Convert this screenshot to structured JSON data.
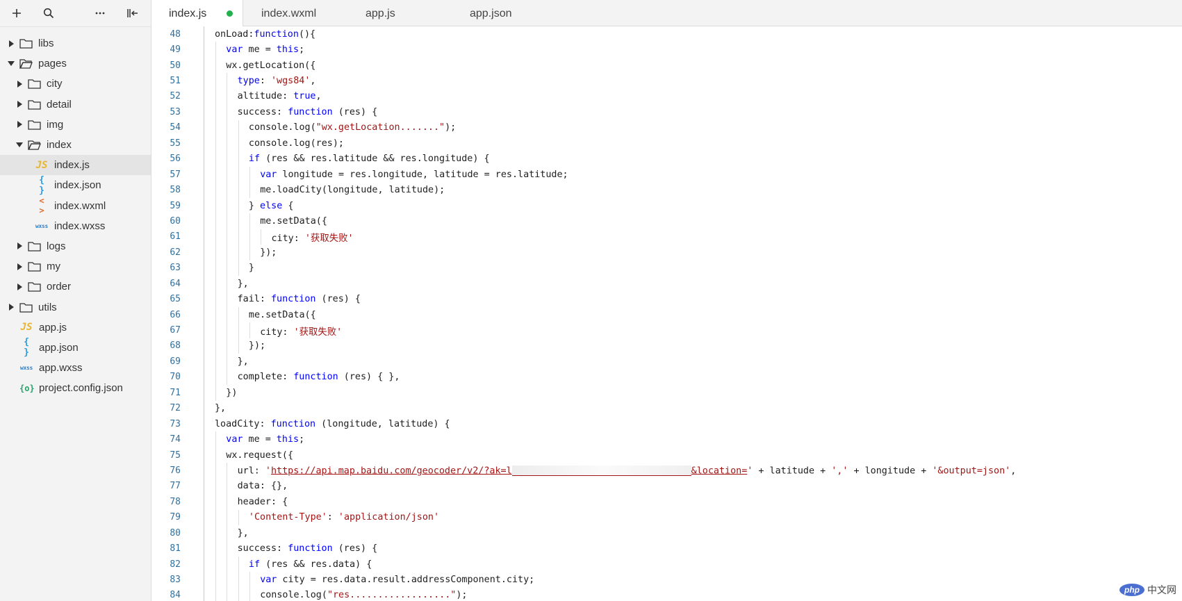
{
  "sidebar": {
    "toolbar": [
      {
        "name": "add-icon",
        "glyph": "+"
      },
      {
        "name": "search-icon",
        "glyph": ""
      },
      {
        "name": "more-icon",
        "glyph": "···"
      },
      {
        "name": "collapse-panel-icon",
        "glyph": ""
      }
    ],
    "tree": [
      {
        "label": "libs",
        "type": "folder",
        "depth": 0,
        "expanded": false
      },
      {
        "label": "pages",
        "type": "folder",
        "depth": 0,
        "expanded": true
      },
      {
        "label": "city",
        "type": "folder",
        "depth": 1,
        "expanded": false
      },
      {
        "label": "detail",
        "type": "folder",
        "depth": 1,
        "expanded": false
      },
      {
        "label": "img",
        "type": "folder",
        "depth": 1,
        "expanded": false
      },
      {
        "label": "index",
        "type": "folder",
        "depth": 1,
        "expanded": true
      },
      {
        "label": "index.js",
        "type": "js",
        "depth": 2,
        "selected": true
      },
      {
        "label": "index.json",
        "type": "json",
        "depth": 2
      },
      {
        "label": "index.wxml",
        "type": "wxml",
        "depth": 2
      },
      {
        "label": "index.wxss",
        "type": "wxss",
        "depth": 2
      },
      {
        "label": "logs",
        "type": "folder",
        "depth": 1,
        "expanded": false
      },
      {
        "label": "my",
        "type": "folder",
        "depth": 1,
        "expanded": false
      },
      {
        "label": "order",
        "type": "folder",
        "depth": 1,
        "expanded": false
      },
      {
        "label": "utils",
        "type": "folder",
        "depth": 0,
        "expanded": false
      },
      {
        "label": "app.js",
        "type": "js",
        "depth": 0
      },
      {
        "label": "app.json",
        "type": "json",
        "depth": 0
      },
      {
        "label": "app.wxss",
        "type": "wxss",
        "depth": 0
      },
      {
        "label": "project.config.json",
        "type": "config",
        "depth": 0
      }
    ],
    "icon_glyphs": {
      "js": "JS",
      "json": "{ }",
      "wxml": "< >",
      "wxss": "wxss",
      "config": "{o}"
    }
  },
  "tabs": [
    {
      "label": "index.js",
      "active": true,
      "modified": true
    },
    {
      "label": "index.wxml",
      "active": false
    },
    {
      "label": "app.js",
      "active": false
    },
    {
      "label": "app.json",
      "active": false
    }
  ],
  "editor": {
    "first_line": 48,
    "lines": [
      {
        "indent": 0,
        "tokens": [
          [
            "p",
            "onLoad:"
          ],
          [
            "k",
            "function"
          ],
          [
            "p",
            "(){"
          ]
        ]
      },
      {
        "indent": 1,
        "tokens": [
          [
            "k",
            "var"
          ],
          [
            "p",
            " me = "
          ],
          [
            "k",
            "this"
          ],
          [
            "p",
            ";"
          ]
        ]
      },
      {
        "indent": 1,
        "tokens": [
          [
            "p",
            "wx.getLocation({"
          ]
        ]
      },
      {
        "indent": 2,
        "tokens": [
          [
            "k",
            "type"
          ],
          [
            "p",
            ": "
          ],
          [
            "s",
            "'wgs84'"
          ],
          [
            "p",
            ","
          ]
        ]
      },
      {
        "indent": 2,
        "tokens": [
          [
            "p",
            "altitude: "
          ],
          [
            "k",
            "true"
          ],
          [
            "p",
            ","
          ]
        ]
      },
      {
        "indent": 2,
        "tokens": [
          [
            "p",
            "success: "
          ],
          [
            "k",
            "function"
          ],
          [
            "p",
            " (res) {"
          ]
        ]
      },
      {
        "indent": 3,
        "tokens": [
          [
            "p",
            "console.log("
          ],
          [
            "s",
            "\"wx.getLocation.......\""
          ],
          [
            "p",
            ");"
          ]
        ]
      },
      {
        "indent": 3,
        "tokens": [
          [
            "p",
            "console.log(res);"
          ]
        ]
      },
      {
        "indent": 3,
        "tokens": [
          [
            "k",
            "if"
          ],
          [
            "p",
            " (res && res.latitude && res.longitude) {"
          ]
        ]
      },
      {
        "indent": 4,
        "tokens": [
          [
            "k",
            "var"
          ],
          [
            "p",
            " longitude = res.longitude, latitude = res.latitude;"
          ]
        ]
      },
      {
        "indent": 4,
        "tokens": [
          [
            "p",
            "me.loadCity(longitude, latitude);"
          ]
        ]
      },
      {
        "indent": 3,
        "tokens": [
          [
            "p",
            "} "
          ],
          [
            "k",
            "else"
          ],
          [
            "p",
            " {"
          ]
        ]
      },
      {
        "indent": 4,
        "tokens": [
          [
            "p",
            "me.setData({"
          ]
        ]
      },
      {
        "indent": 5,
        "tokens": [
          [
            "p",
            "city: "
          ],
          [
            "s",
            "'获取失败'"
          ]
        ]
      },
      {
        "indent": 4,
        "tokens": [
          [
            "p",
            "});"
          ]
        ]
      },
      {
        "indent": 3,
        "tokens": [
          [
            "p",
            "}"
          ]
        ]
      },
      {
        "indent": 2,
        "tokens": [
          [
            "p",
            "},"
          ]
        ]
      },
      {
        "indent": 2,
        "tokens": [
          [
            "p",
            "fail: "
          ],
          [
            "k",
            "function"
          ],
          [
            "p",
            " (res) {"
          ]
        ]
      },
      {
        "indent": 3,
        "tokens": [
          [
            "p",
            "me.setData({"
          ]
        ]
      },
      {
        "indent": 4,
        "tokens": [
          [
            "p",
            "city: "
          ],
          [
            "s",
            "'获取失败'"
          ]
        ]
      },
      {
        "indent": 3,
        "tokens": [
          [
            "p",
            "});"
          ]
        ]
      },
      {
        "indent": 2,
        "tokens": [
          [
            "p",
            "},"
          ]
        ]
      },
      {
        "indent": 2,
        "tokens": [
          [
            "p",
            "complete: "
          ],
          [
            "k",
            "function"
          ],
          [
            "p",
            " (res) { },"
          ]
        ]
      },
      {
        "indent": 1,
        "tokens": [
          [
            "p",
            "})"
          ]
        ]
      },
      {
        "indent": 0,
        "tokens": [
          [
            "p",
            "},"
          ]
        ]
      },
      {
        "indent": 0,
        "tokens": [
          [
            "p",
            "loadCity: "
          ],
          [
            "k",
            "function"
          ],
          [
            "p",
            " (longitude, latitude) {"
          ]
        ]
      },
      {
        "indent": 1,
        "tokens": [
          [
            "k",
            "var"
          ],
          [
            "p",
            " me = "
          ],
          [
            "k",
            "this"
          ],
          [
            "p",
            ";"
          ]
        ]
      },
      {
        "indent": 1,
        "tokens": [
          [
            "p",
            "wx.request({"
          ]
        ]
      },
      {
        "indent": 2,
        "tokens": [
          [
            "p",
            "url: "
          ],
          [
            "s",
            "'"
          ],
          [
            "u",
            "https://api.map.baidu.com/geocoder/v2/?ak=l"
          ],
          [
            "b",
            ""
          ],
          [
            "u",
            "&location="
          ],
          [
            "s",
            "'"
          ],
          [
            "p",
            " + latitude + "
          ],
          [
            "s",
            "','"
          ],
          [
            "p",
            " + longitude + "
          ],
          [
            "s",
            "'&output=json'"
          ],
          [
            "p",
            ","
          ]
        ]
      },
      {
        "indent": 2,
        "tokens": [
          [
            "p",
            "data: {},"
          ]
        ]
      },
      {
        "indent": 2,
        "tokens": [
          [
            "p",
            "header: {"
          ]
        ]
      },
      {
        "indent": 3,
        "tokens": [
          [
            "s",
            "'Content-Type'"
          ],
          [
            "p",
            ": "
          ],
          [
            "s",
            "'application/json'"
          ]
        ]
      },
      {
        "indent": 2,
        "tokens": [
          [
            "p",
            "},"
          ]
        ]
      },
      {
        "indent": 2,
        "tokens": [
          [
            "p",
            "success: "
          ],
          [
            "k",
            "function"
          ],
          [
            "p",
            " (res) {"
          ]
        ]
      },
      {
        "indent": 3,
        "tokens": [
          [
            "k",
            "if"
          ],
          [
            "p",
            " (res && res.data) {"
          ]
        ]
      },
      {
        "indent": 4,
        "tokens": [
          [
            "k",
            "var"
          ],
          [
            "p",
            " city = res.data.result.addressComponent.city;"
          ]
        ]
      },
      {
        "indent": 4,
        "tokens": [
          [
            "p",
            "console.log("
          ],
          [
            "s",
            "\"res..................\""
          ],
          [
            "p",
            ");"
          ]
        ]
      }
    ]
  },
  "watermark": {
    "logo": "php",
    "text": "中文网"
  }
}
